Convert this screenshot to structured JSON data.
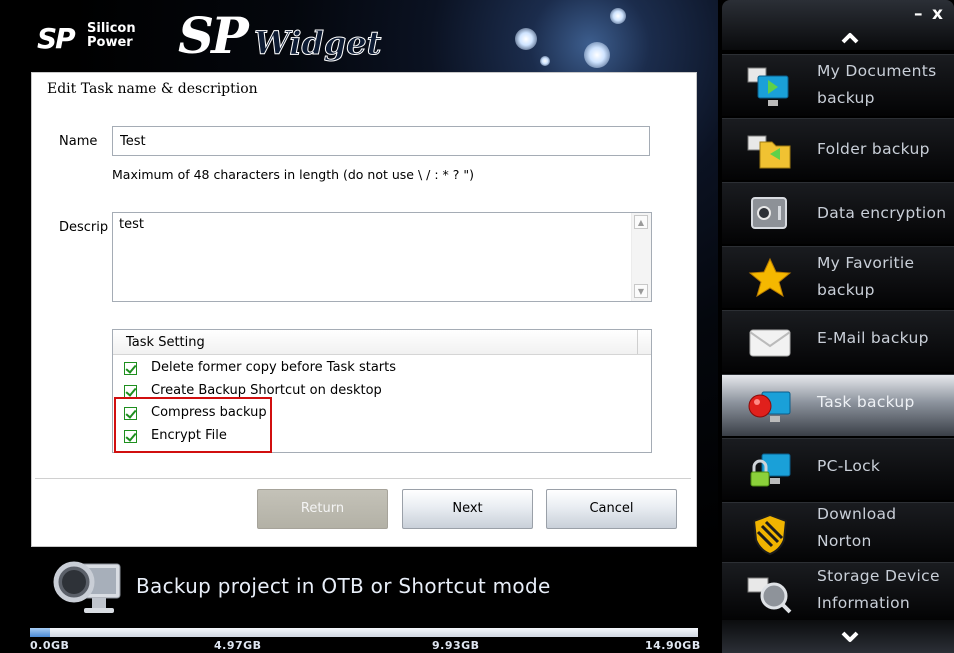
{
  "brand": {
    "mark": "SP",
    "line1": "Silicon",
    "line2": "Power",
    "product_sp": "SP",
    "product_name": "Widget"
  },
  "dialog": {
    "title": "Edit Task name & description",
    "name_label": "Name",
    "name_value": "Test",
    "name_hint": "Maximum of 48 characters in length (do not use \\ / : * ? \")",
    "descrip_label": "Descrip",
    "descrip_value": "test",
    "task_setting_header": "Task Setting",
    "options": [
      {
        "label": "Delete former copy before Task starts",
        "checked": true
      },
      {
        "label": "Create Backup Shortcut on desktop",
        "checked": true
      },
      {
        "label": "Compress backup",
        "checked": true
      },
      {
        "label": "Encrypt File",
        "checked": true
      }
    ],
    "buttons": {
      "return": "Return",
      "next": "Next",
      "cancel": "Cancel"
    }
  },
  "status": {
    "message": "Backup project in OTB or Shortcut mode",
    "icon": "magnifier-monitor-icon"
  },
  "capacity": {
    "labels": [
      "0.0GB",
      "4.97GB",
      "9.93GB",
      "14.90GB"
    ],
    "used_fraction": 0.03
  },
  "window": {
    "minimize": "–",
    "close": "x"
  },
  "sidebar": {
    "items": [
      {
        "label_line1": "My Documents",
        "label_line2": "backup",
        "icon": "my-documents-icon"
      },
      {
        "label_line1": "Folder backup",
        "label_line2": "",
        "icon": "folder-backup-icon"
      },
      {
        "label_line1": "Data encryption",
        "label_line2": "",
        "icon": "safe-icon"
      },
      {
        "label_line1": "My Favoritie",
        "label_line2": "backup",
        "icon": "star-icon"
      },
      {
        "label_line1": "E-Mail backup",
        "label_line2": "",
        "icon": "envelope-icon"
      },
      {
        "label_line1": "Task backup",
        "label_line2": "",
        "icon": "task-backup-icon",
        "active": true
      },
      {
        "label_line1": "PC-Lock",
        "label_line2": "",
        "icon": "lock-monitor-icon"
      },
      {
        "label_line1": "Download",
        "label_line2": "Norton",
        "icon": "norton-shield-icon"
      },
      {
        "label_line1": "Storage Device",
        "label_line2": "Information",
        "icon": "storage-info-icon"
      }
    ]
  },
  "colors": {
    "highlight": "#d10f0f",
    "check": "#1e8f1e",
    "active_item": "#c8ccd3"
  }
}
